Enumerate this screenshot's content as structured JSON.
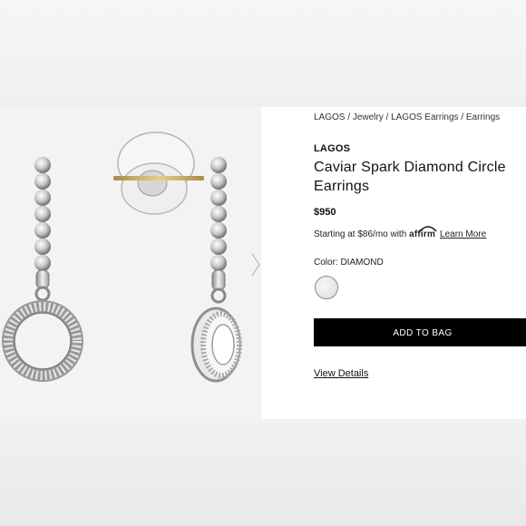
{
  "breadcrumb": [
    "LAGOS",
    "Jewelry",
    "LAGOS Earrings",
    "Earrings"
  ],
  "breadcrumb_separator": " / ",
  "product": {
    "brand": "LAGOS",
    "title": "Caviar Spark Diamond Circle Earrings",
    "price": "$950",
    "image_alt_icon": "earrings-photo"
  },
  "financing": {
    "prefix": "Starting at $86/mo with",
    "provider": "affirm",
    "link": "Learn More"
  },
  "color": {
    "label": "Color: DIAMOND",
    "swatch_color": "#e2e2e2"
  },
  "actions": {
    "add_to_bag": "ADD TO BAG",
    "view_details": "View Details"
  },
  "colors": {
    "accent": "#000000",
    "background": "#ececec",
    "panel": "#ffffff"
  }
}
